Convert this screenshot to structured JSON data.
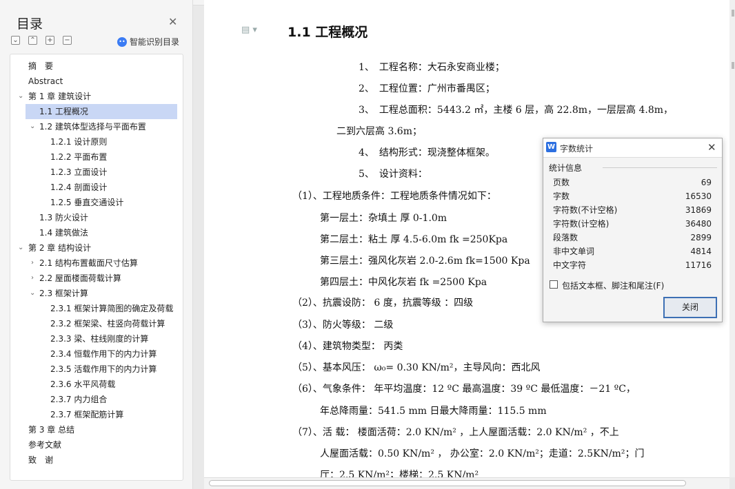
{
  "toc": {
    "title": "目录",
    "ai_label": "智能识别目录",
    "items": [
      {
        "label": "摘　要"
      },
      {
        "label": "Abstract"
      },
      {
        "label": "第 1 章  建筑设计"
      },
      {
        "label": "1.1 工程概况"
      },
      {
        "label": "1.2 建筑体型选择与平面布置"
      },
      {
        "label": "1.2.1 设计原则"
      },
      {
        "label": "1.2.2 平面布置"
      },
      {
        "label": "1.2.3 立面设计"
      },
      {
        "label": "1.2.4 剖面设计"
      },
      {
        "label": "1.2.5 垂直交通设计"
      },
      {
        "label": "1.3 防火设计"
      },
      {
        "label": "1.4 建筑做法"
      },
      {
        "label": "第 2 章  结构设计"
      },
      {
        "label": "2.1 结构布置截面尺寸估算"
      },
      {
        "label": "2.2 屋面楼面荷载计算"
      },
      {
        "label": "2.3 框架计算"
      },
      {
        "label": "2.3.1 框架计算简图的确定及荷载"
      },
      {
        "label": "2.3.2 框架梁、柱竖向荷载计算"
      },
      {
        "label": "2.3.3 梁、柱线刚度的计算"
      },
      {
        "label": "2.3.4 恒载作用下的内力计算"
      },
      {
        "label": "2.3.5 活载作用下的内力计算"
      },
      {
        "label": "2.3.6 水平风荷载"
      },
      {
        "label": "2.3.7 内力组合"
      },
      {
        "label": "2.3.7 框架配筋计算"
      },
      {
        "label": "第 3 章  总结"
      },
      {
        "label": "参考文献"
      },
      {
        "label": "致　谢"
      }
    ]
  },
  "document": {
    "heading": "1.1 工程概况",
    "lines": [
      "1、　工程名称：大石永安商业楼；",
      "2、　工程位置：广州市番禺区；",
      "3、　工程总面积：5443.2 ㎡，主楼 6 层，高 22.8m，一层层高 4.8m，",
      "二到六层高 3.6m；",
      "4、　结构形式：现浇整体框架。",
      "5、　设计资料：",
      "（1）、工程地质条件：工程地质条件情况如下：",
      "第一层土：杂填土  厚 0-1.0m",
      "第二层土：粘土  厚 4.5-6.0m  fk =250Kpa",
      "第三层土：强风化灰岩 2.0-2.6m  fk=1500 Kpa",
      "第四层土：中风化灰岩 fk =2500 Kpa",
      "（2）、抗震设防：    6  度，抗震等级 ：四级",
      "（3）、防火等级：      二级",
      "（4）、建筑物类型：    丙类",
      "（5）、基本风压：      ω₀= 0.30 KN/m²，主导风向：西北风",
      "（6）、气象条件：      年平均温度：12 ºC   最高温度：39 ºC   最低温度：－21 ºC，",
      "年总降雨量：541.5 mm      日最大降雨量：115.5 mm",
      "（7）、活     载：   楼面活荷：2.0   KN/m² ，上人屋面活载：2.0 KN/m² ，不上",
      "人屋面活载：0.50 KN/m²  ，   办公室：2.0 KN/m²；走道：2.5KN/m²；门",
      "厅：2.5 KN/m²；楼梯：2.5 KN/m²"
    ]
  },
  "word_count": {
    "title": "字数统计",
    "section": "统计信息",
    "rows": [
      {
        "label": "页数",
        "value": "69"
      },
      {
        "label": "字数",
        "value": "16530"
      },
      {
        "label": "字符数(不计空格)",
        "value": "31869"
      },
      {
        "label": "字符数(计空格)",
        "value": "36480"
      },
      {
        "label": "段落数",
        "value": "2899"
      },
      {
        "label": "非中文单词",
        "value": "4814"
      },
      {
        "label": "中文字符",
        "value": "11716"
      }
    ],
    "checkbox_label": "包括文本框、脚注和尾注(F)",
    "close_label": "关闭"
  }
}
